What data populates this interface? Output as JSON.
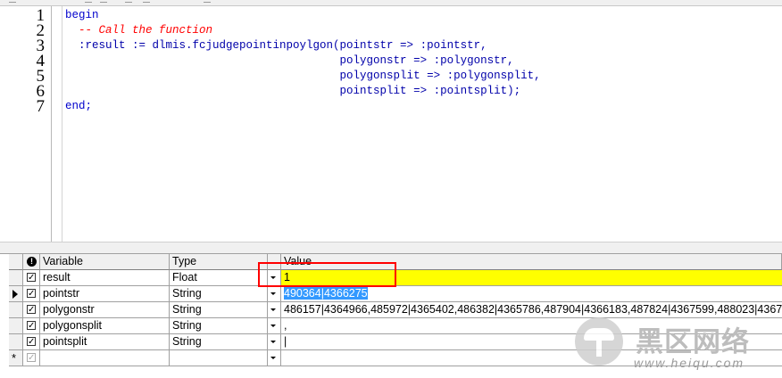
{
  "editor": {
    "line_numbers": [
      "1",
      "2",
      "3",
      "4",
      "5",
      "6",
      "7"
    ],
    "lines": [
      {
        "kw": "begin"
      },
      {
        "comment": "  -- Call the function"
      },
      {
        "text": "  :result := dlmis.fcjudgepointinpoylgon(pointstr => :pointstr,"
      },
      {
        "text": "                                         polygonstr => :polygonstr,"
      },
      {
        "text": "                                         polygonsplit => :polygonsplit,"
      },
      {
        "text": "                                         pointsplit => :pointsplit);"
      },
      {
        "kw": "end;"
      }
    ]
  },
  "grid": {
    "headers": {
      "variable": "Variable",
      "type": "Type",
      "value": "Value"
    },
    "rows": [
      {
        "variable": "result",
        "type": "Float",
        "value": "1",
        "checked": true,
        "highlight": "#ffff00"
      },
      {
        "variable": "pointstr",
        "type": "String",
        "value": "490364|4366275",
        "checked": true,
        "selected": true,
        "current": true
      },
      {
        "variable": "polygonstr",
        "type": "String",
        "value": "486157|4364966,485972|4365402,486382|4365786,487904|4366183,487824|4367599,488023|4367",
        "checked": true
      },
      {
        "variable": "polygonsplit",
        "type": "String",
        "value": ",",
        "checked": true
      },
      {
        "variable": "pointsplit",
        "type": "String",
        "value": "|",
        "checked": true
      }
    ],
    "new_row_marker": "*"
  },
  "watermark": {
    "cn_text": "黑区网络",
    "url": "www.heiqu.com"
  },
  "colors": {
    "keyword": "#0000cc",
    "comment": "#ff0000",
    "highlight": "#ffff00",
    "selection": "#3399ff",
    "annotation_box": "#ff0000"
  }
}
